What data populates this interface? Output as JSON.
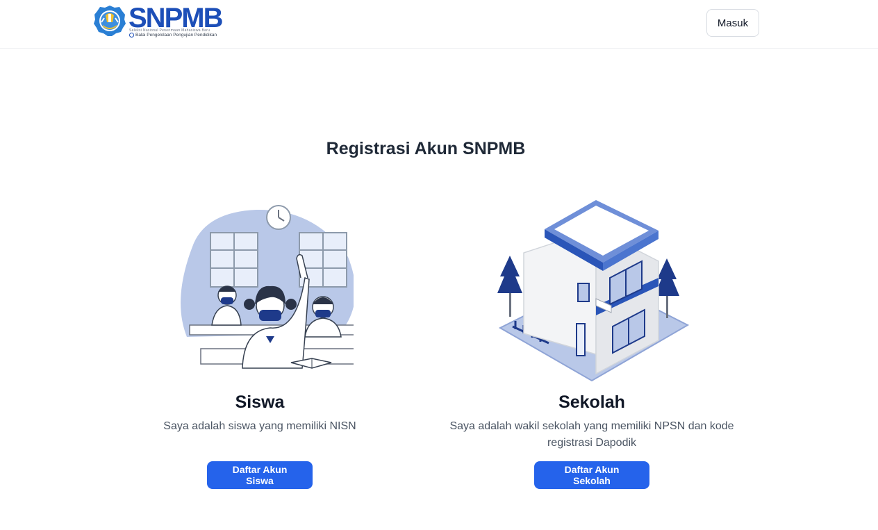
{
  "brand": {
    "name": "SNPMB",
    "subtitle": "Seleksi Nasional Penerimaan Mahasiswa Baru",
    "org": "Balai Pengelolaan Pengujian Pendidikan"
  },
  "header": {
    "login_label": "Masuk"
  },
  "main": {
    "title": "Registrasi Akun SNPMB",
    "cards": [
      {
        "title": "Siswa",
        "description": "Saya adalah siswa yang memiliki NISN",
        "button": "Daftar Akun Siswa",
        "illustration": "students-classroom-illustration"
      },
      {
        "title": "Sekolah",
        "description": "Saya adalah wakil sekolah yang memiliki NPSN dan kode registrasi Dapodik",
        "button": "Daftar Akun Sekolah",
        "illustration": "school-building-illustration"
      }
    ]
  },
  "colors": {
    "primary": "#2563eb",
    "brand": "#1d4fb8",
    "illustration": "#b9c8e8"
  }
}
